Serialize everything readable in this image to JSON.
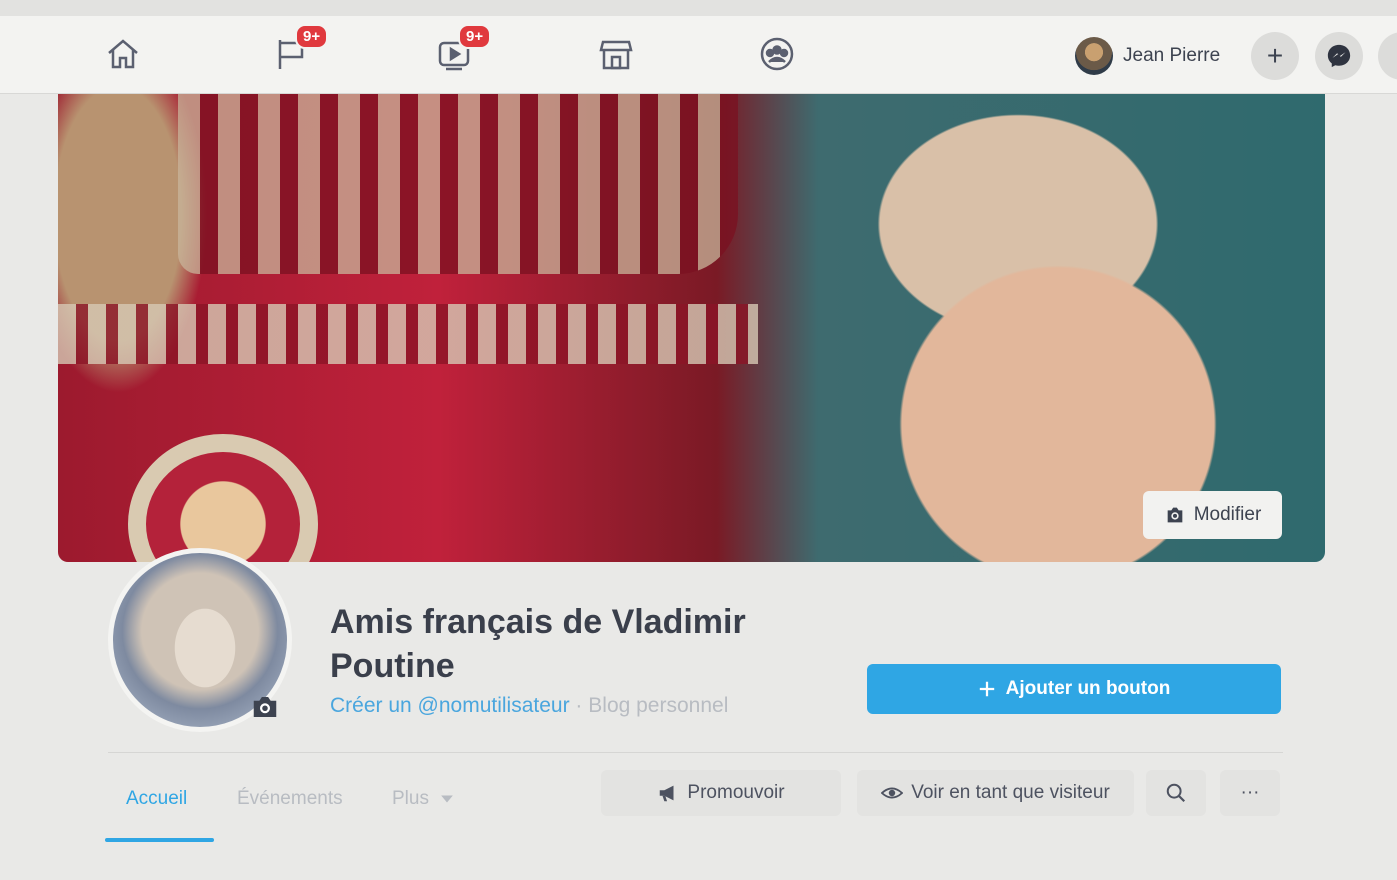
{
  "nav": {
    "badges": {
      "pages": "9+",
      "watch": "9+"
    },
    "icons": [
      "home-icon",
      "flag-icon",
      "video-icon",
      "marketplace-icon",
      "groups-icon"
    ],
    "user_name": "Jean Pierre",
    "create_label": "+"
  },
  "cover": {
    "modify_label": "Modifier"
  },
  "page": {
    "title": "Amis français de Vladimir Poutine",
    "username_link": "Créer un @nomutilisateur",
    "separator": " · ",
    "category": "Blog personnel",
    "add_button_label": "Ajouter un bouton"
  },
  "tabs": {
    "home": "Accueil",
    "events": "Événements",
    "more": "Plus"
  },
  "actions": {
    "promote": "Promouvoir",
    "view_as": "Voir en tant que visiteur",
    "more_dots": "···"
  },
  "colors": {
    "accent": "#2fa6e4",
    "badge": "#e0393e",
    "text": "#3a3f4b"
  }
}
